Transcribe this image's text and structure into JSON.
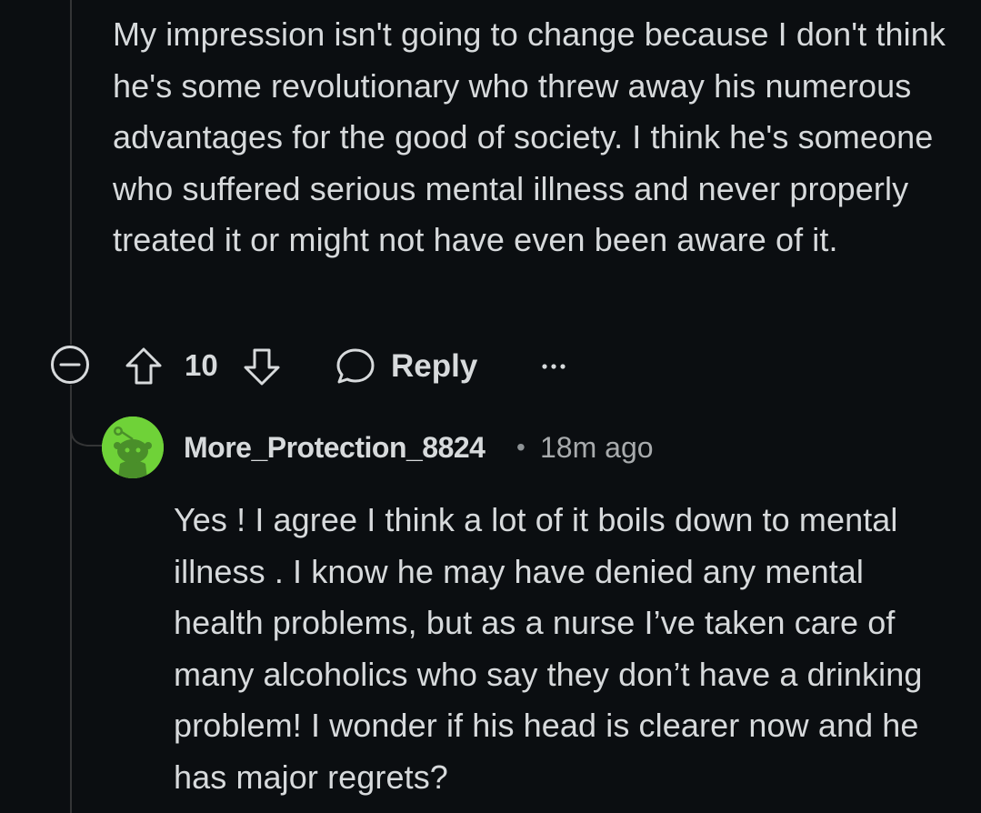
{
  "parent_comment": {
    "body": "My impression isn't going to change because I don't think he's some revolutionary who threw away his numerous advantages for the good of society. I think he's someone who suffered serious mental illness and never properly treated it or might not have even been aware of it.",
    "vote_count": "10",
    "reply_label": "Reply",
    "icons": {
      "collapse": "collapse-minus-icon",
      "upvote": "upvote-arrow-icon",
      "downvote": "downvote-arrow-icon",
      "reply": "speech-bubble-icon",
      "more": "ellipsis-icon"
    }
  },
  "reply_comment": {
    "username": "More_Protection_8824",
    "separator": "•",
    "timestamp": "18m ago",
    "body": "Yes ! I agree I think a lot of it boils down to mental illness . I know he may have denied any mental health problems, but as a nurse I’ve taken care of many alcoholics who say they don’t have a drinking problem! I wonder if his head is clearer now and he has major regrets?",
    "avatar_icon": "snoo-avatar-icon"
  },
  "colors": {
    "background": "#0b0e11",
    "text": "#d7dadc",
    "muted_text": "#a8abad",
    "thread_line": "#343536",
    "avatar_bg": "#6fd238"
  }
}
